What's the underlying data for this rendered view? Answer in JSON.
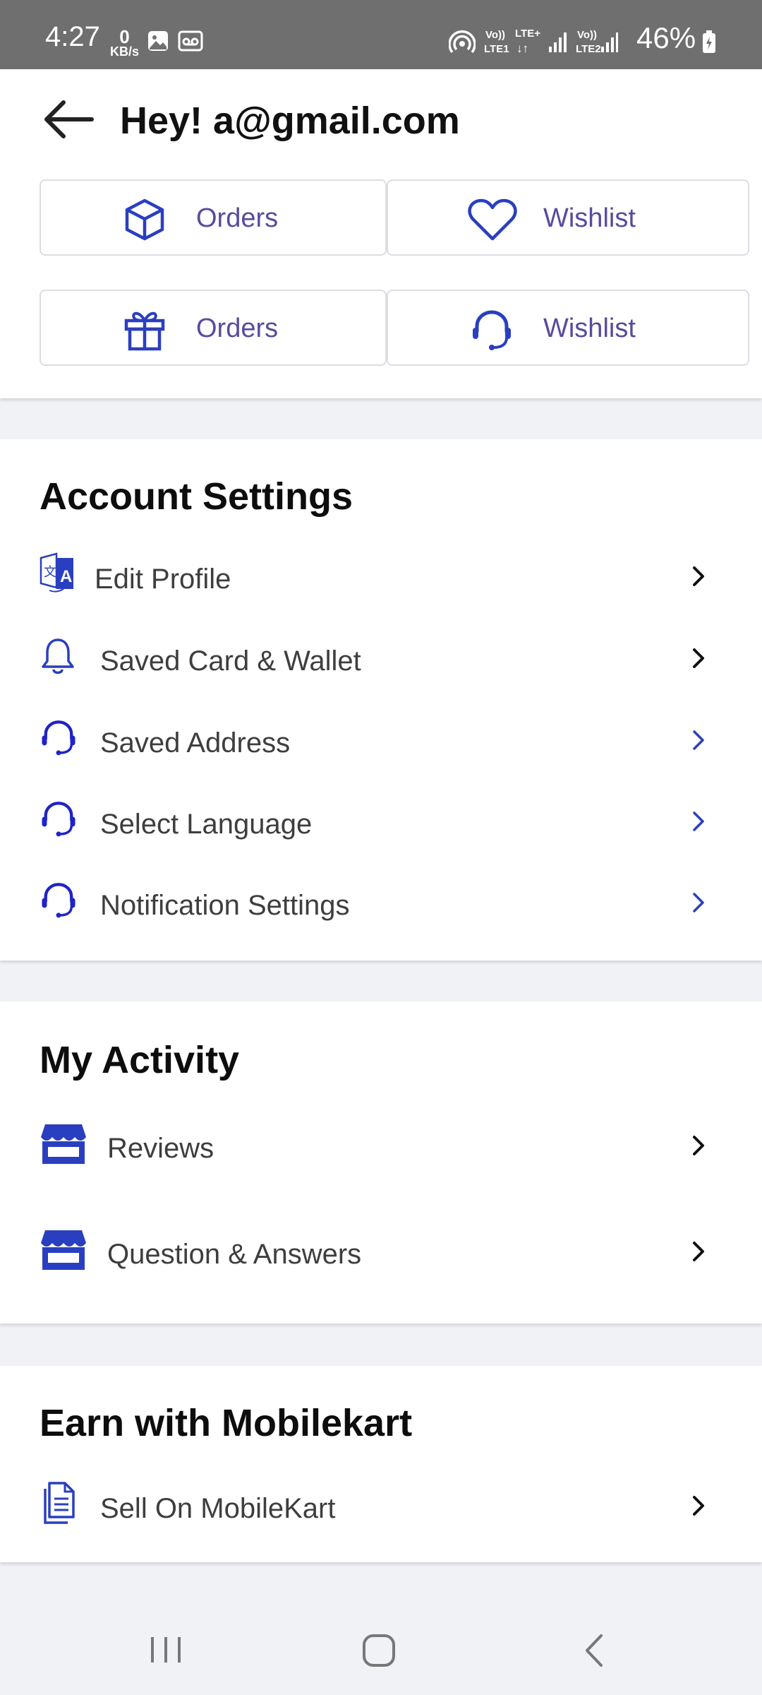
{
  "status_bar": {
    "time": "4:27",
    "net_speed_value": "0",
    "net_speed_unit": "KB/s",
    "battery": "46%"
  },
  "header": {
    "title": "Hey! a@gmail.com"
  },
  "quick_actions": [
    {
      "label": "Orders",
      "icon": "box-icon"
    },
    {
      "label": "Wishlist",
      "icon": "heart-icon"
    },
    {
      "label": "Orders",
      "icon": "gift-icon"
    },
    {
      "label": "Wishlist",
      "icon": "headset-icon"
    }
  ],
  "account_settings": {
    "title": "Account Settings",
    "items": [
      {
        "label": "Edit Profile",
        "icon": "translate-icon"
      },
      {
        "label": "Saved Card & Wallet",
        "icon": "bell-icon"
      },
      {
        "label": "Saved Address",
        "icon": "headset-icon"
      },
      {
        "label": "Select Language",
        "icon": "headset-icon"
      },
      {
        "label": "Notification Settings",
        "icon": "headset-icon"
      }
    ]
  },
  "my_activity": {
    "title": "My Activity",
    "items": [
      {
        "label": "Reviews",
        "icon": "store-icon"
      },
      {
        "label": "Question & Answers",
        "icon": "store-icon"
      }
    ]
  },
  "earn": {
    "title": "Earn with Mobilekart",
    "items": [
      {
        "label": "Sell On MobileKart",
        "icon": "document-icon"
      }
    ]
  },
  "colors": {
    "accent": "#2a3fbf",
    "label_purple": "#5a4a9e",
    "status_bar": "#6f6f6f"
  }
}
